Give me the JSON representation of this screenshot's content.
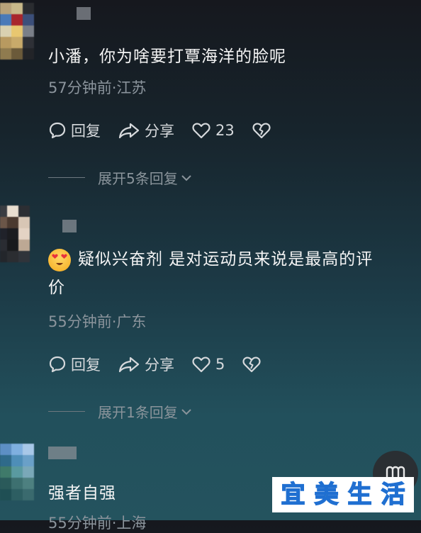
{
  "comments": [
    {
      "text": "小潘，你为啥要打覃海洋的脸呢",
      "meta": "57分钟前·江苏",
      "reply_label": "回复",
      "share_label": "分享",
      "likes": "23",
      "expand_label": "展开5条回复"
    },
    {
      "text_line1": "疑似兴奋剂 是对运动员来说是最高的评",
      "text_line2": "价",
      "meta": "55分钟前·广东",
      "reply_label": "回复",
      "share_label": "分享",
      "likes": "5",
      "expand_label": "展开1条回复"
    },
    {
      "text": "强者自强",
      "meta": "55分钟前·上海"
    }
  ],
  "watermark": {
    "chars": [
      "宜",
      "美",
      "生",
      "活"
    ],
    "colors": [
      "#4fb3f0",
      "#ffe53b",
      "#ff5fa2",
      "#7ed957"
    ]
  },
  "icons": {
    "reply": "speech-bubble-icon",
    "share": "share-arrow-icon",
    "like": "heart-icon",
    "dislike": "broken-heart-icon",
    "expand": "chevron-down-icon",
    "float": "menu-icon"
  }
}
